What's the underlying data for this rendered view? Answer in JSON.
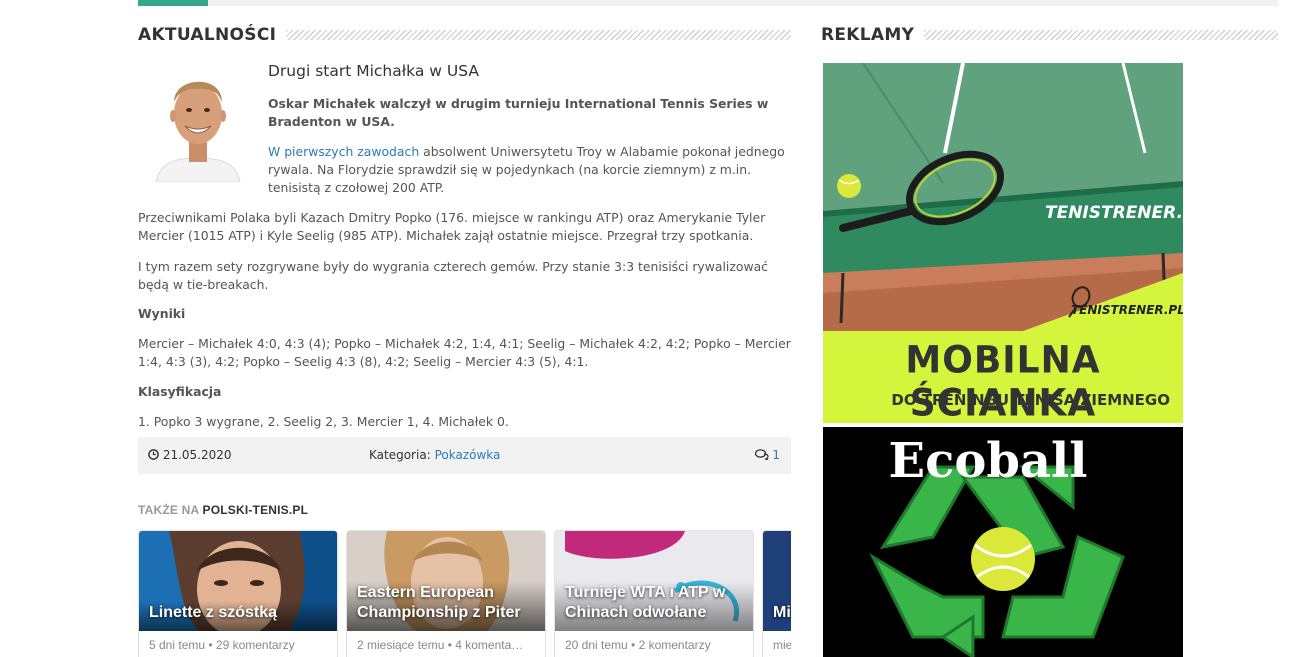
{
  "news": {
    "heading": "AKTUALNOŚCI",
    "article": {
      "title": "Drugi start Michałka w USA",
      "lead": "Oskar Michałek walczył w drugim turnieju International Tennis Series w Bradenton w USA.",
      "p1_link": "W pierwszych zawodach",
      "p1_rest": " absolwent Uniwersytetu Troy w Alabamie pokonał jednego rywala. Na Florydzie sprawdził się w pojedynkach (na korcie ziemnym) z m.in. tenisistą z czołowej 200 ATP.",
      "p2": "Przeciwnikami Polaka byli Kazach Dmitry Popko (176. miejsce w rankingu ATP) oraz Amerykanie Tyler Mercier (1015 ATP) i Kyle Seelig (985 ATP). Michałek zajął ostatnie miejsce. Przegrał trzy spotkania.",
      "p3": "I tym razem sety rozgrywane były do wygrania czterech gemów. Przy stanie 3:3 tenisiści rywalizować będą w tie-breakach.",
      "results_heading": "Wyniki",
      "results": "Mercier – Michałek 4:0, 4:3 (4); Popko – Michałek 4:2, 1:4, 4:1; Seelig – Michałek 4:2, 4:2; Popko – Mercier 1:4, 4:3 (3), 4:2; Popko – Seelig 4:3 (8), 4:2; Seelig – Mercier 4:3 (5), 4:1.",
      "class_heading": "Klasyfikacja",
      "classification": "1. Popko 3 wygrane, 2. Seelig 2, 3. Mercier 1, 4. Michałek 0.",
      "date": "21.05.2020",
      "category_label": "Kategoria:",
      "category": "Pokazówka",
      "comments": "1"
    },
    "also_prefix": "TAKŻE NA",
    "also_site": "POLSKI-TENIS.PL",
    "cards": [
      {
        "title": "Linette z szóstką",
        "sub": "5 dni temu • 29 komentarzy"
      },
      {
        "title": "Eastern European Championship z Piter",
        "sub": "2 miesiące temu • 4 komenta…"
      },
      {
        "title": "Turnieje WTA i ATP w Chinach odwołane",
        "sub": "20 dni temu • 2 komentarzy"
      },
      {
        "title": "Mi… Ko…",
        "sub": "mie…"
      }
    ]
  },
  "ads": {
    "heading": "REKLAMY",
    "ad1": {
      "brand": "TENISTRENER.PL",
      "headline": "MOBILNA ŚCIANKA",
      "subline": "DO TRENINGU TENISA ZIEMNEGO",
      "accent": "#d4f53c"
    },
    "ad2": {
      "brand": "Ecoball",
      "accent": "#39b54a"
    }
  },
  "colors": {
    "link": "#2b7bb9",
    "accent": "#36a88a"
  },
  "icons": [
    "clock-icon",
    "comments-icon",
    "recycle-icon",
    "tennis-ball-icon",
    "tennis-racket-icon"
  ]
}
